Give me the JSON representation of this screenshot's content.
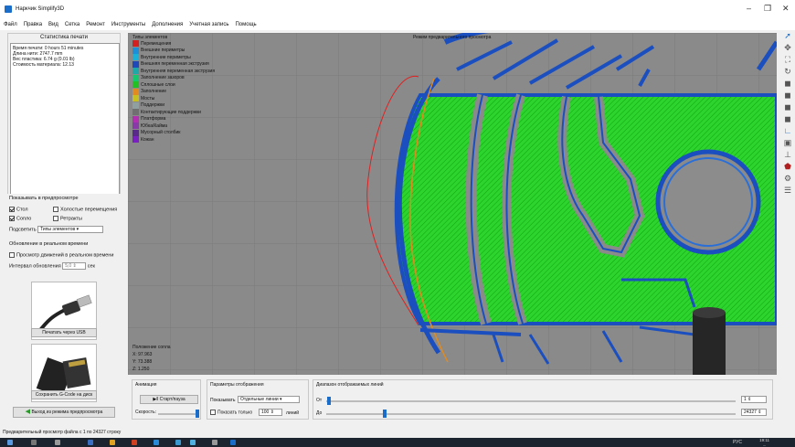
{
  "window": {
    "title": "Наркчик Simplify3D",
    "minimize": "–",
    "maximize": "❐",
    "close": "✕"
  },
  "menu": [
    "Файл",
    "Правка",
    "Вид",
    "Сетка",
    "Ремонт",
    "Инструменты",
    "Дополнения",
    "Учетная запись",
    "Помощь"
  ],
  "stats": {
    "title": "Статистика печати",
    "lines": [
      "Время печати: 0 hours 51 minutes",
      "Длина нити: 2747.7 mm",
      "Вес пластика: 6.74 g (0.01 lb)",
      "Стоимость материала: 12.13"
    ]
  },
  "preview": {
    "title": "Показывать в предпросмотре",
    "opt_table": "Стол",
    "opt_idle": "Холостые перемещения",
    "opt_nozzle": "Сопло",
    "opt_retract": "Ретракты",
    "highlight_label": "Подсветить",
    "highlight_value": "Типы элементов"
  },
  "realtime": {
    "title": "Обновление в реальном времени",
    "opt_view": "Просмотр движений в реальном времени",
    "interval_label": "Интервал обновления",
    "interval_value": "5,0",
    "interval_unit": "сек"
  },
  "buttons": {
    "usb": "Печатать через USB",
    "save_gcode": "Сохранить G-Code на диск",
    "exit_preview": "Выход из режима предпросмотра"
  },
  "viewport": {
    "legend_title": "Типы элементов",
    "mode_title": "Режим предварительного просмотра",
    "legend": [
      {
        "label": "Перемещения",
        "color": "#d32020"
      },
      {
        "label": "Внешние периметры",
        "color": "#1d8fd8"
      },
      {
        "label": "Внутренние периметры",
        "color": "#1ab0d8"
      },
      {
        "label": "Внешняя переменная экструзия",
        "color": "#1f49b8"
      },
      {
        "label": "Внутренняя переменная экструзия",
        "color": "#1fa8a8"
      },
      {
        "label": "Заполнение зазоров",
        "color": "#15c870"
      },
      {
        "label": "Сплошные слои",
        "color": "#22c022"
      },
      {
        "label": "Заполнение",
        "color": "#e08a20"
      },
      {
        "label": "Мосты",
        "color": "#c8c020"
      },
      {
        "label": "Поддержки",
        "color": "#90a0a0"
      },
      {
        "label": "Контактирующие поддержки",
        "color": "#707070"
      },
      {
        "label": "Платформа",
        "color": "#b030b0"
      },
      {
        "label": "Юбка/Кайма",
        "color": "#8a3aa8"
      },
      {
        "label": "Мусорный столбик",
        "color": "#5a2a8a"
      },
      {
        "label": "Кожан",
        "color": "#7a20c0"
      }
    ],
    "nozzle_title": "Положение сопла",
    "x": "X: 97.963",
    "y": "Y: 73.388",
    "z": "Z: 1.250"
  },
  "animation": {
    "title": "Анимация",
    "play": "Старт/пауза",
    "speed_label": "Скорость:"
  },
  "display": {
    "title": "Параметры отображения",
    "show_label": "Показывать",
    "show_value": "Отдельные линии",
    "only_label": "Показать только",
    "only_value": "100",
    "only_unit": "линий"
  },
  "range": {
    "title": "Диапазон отображаемых линий",
    "from_label": "От",
    "from_value": "1",
    "to_label": "До",
    "to_value": "24327"
  },
  "status": "Предварительный просмотр файла с 1 по 24327 строку",
  "taskbar": {
    "lang": "РУС",
    "time": "19:11",
    "date": "..."
  }
}
